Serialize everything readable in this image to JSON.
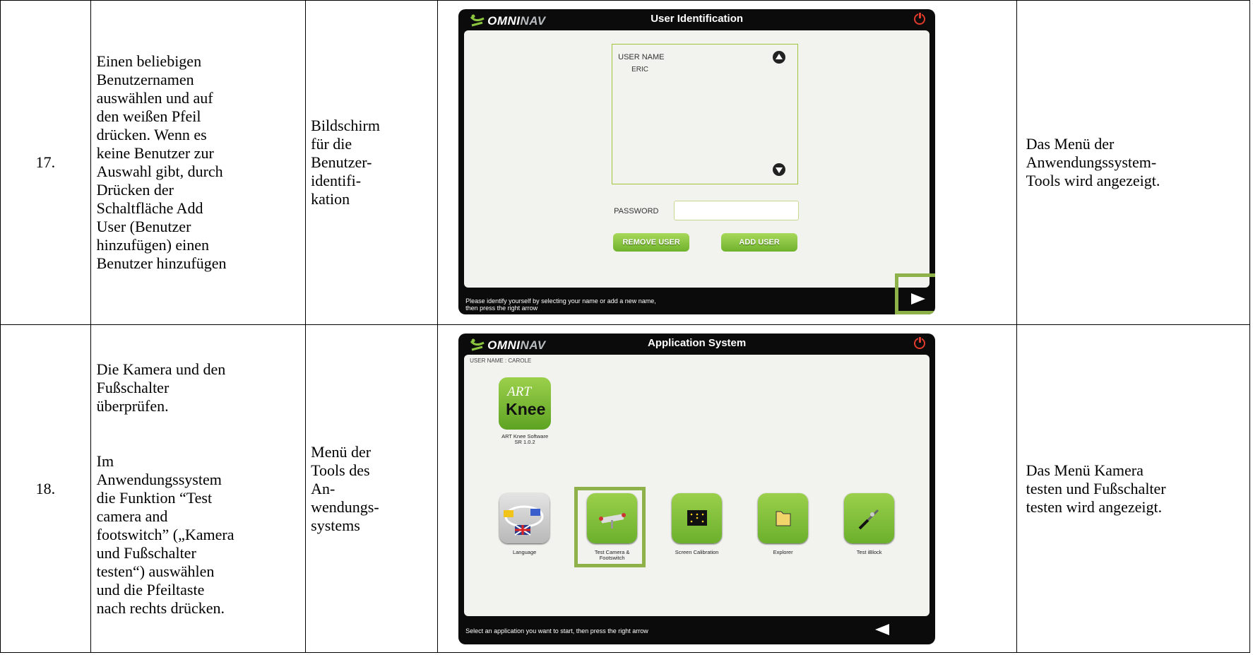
{
  "rows": [
    {
      "number": "17.",
      "action": "Einen beliebigen\nBenutzernamen\nauswählen und auf\nden weißen Pfeil\ndrücken. Wenn es\nkeine Benutzer zur\nAuswahl gibt, durch\nDrücken der\nSchaltfläche Add\nUser (Benutzer\nhinzufügen) einen\nBenutzer hinzufügen",
      "screen_name": "Bildschirm\nfür die\nBenutzer-\nidentifi-\nkation",
      "result": "Das Menü der\nAnwendungssystem-\nTools wird angezeigt.",
      "screenshot": {
        "brand": "OMNI",
        "brand_suffix": "NAV",
        "title": "User Identification",
        "list_label": "USER NAME",
        "user": "ERIC",
        "password_label": "PASSWORD",
        "remove_button": "REMOVE USER",
        "add_button": "ADD USER",
        "status": "Please identify yourself by selecting your name or add a new name,\nthen press the right arrow"
      }
    },
    {
      "number": "18.",
      "action": "Die Kamera und den\nFußschalter\nüberprüfen.\n\n\nIm\nAnwendungssystem\ndie Funktion “Test\ncamera and\nfootswitch” („Kamera\nund Fußschalter\ntesten“) auswählen\nund die Pfeiltaste\nnach rechts drücken.",
      "screen_name": "Menü der\nTools des\nAn-\nwendungs-\nsystems",
      "result": "Das Menü Kamera\ntesten und Fußschalter\ntesten wird angezeigt.",
      "screenshot": {
        "brand": "OMNI",
        "brand_suffix": "NAV",
        "title": "Application System",
        "user_name": "USER NAME : CAROLE",
        "software_label": "ART Knee Software\nSR 1.0.2",
        "art_top": "ART",
        "art_bottom": "Knee",
        "tiles": [
          {
            "label": "Language"
          },
          {
            "label": "Test Camera &\nFootswitch"
          },
          {
            "label": "Screen Calibration"
          },
          {
            "label": "Explorer"
          },
          {
            "label": "Test iBlock"
          }
        ],
        "status": "Select an application you want to start, then press the right arrow"
      }
    }
  ],
  "colors": {
    "accent_green": "#8fb14a",
    "button_green": "#6fb22c",
    "power_red": "#e03b2b"
  }
}
